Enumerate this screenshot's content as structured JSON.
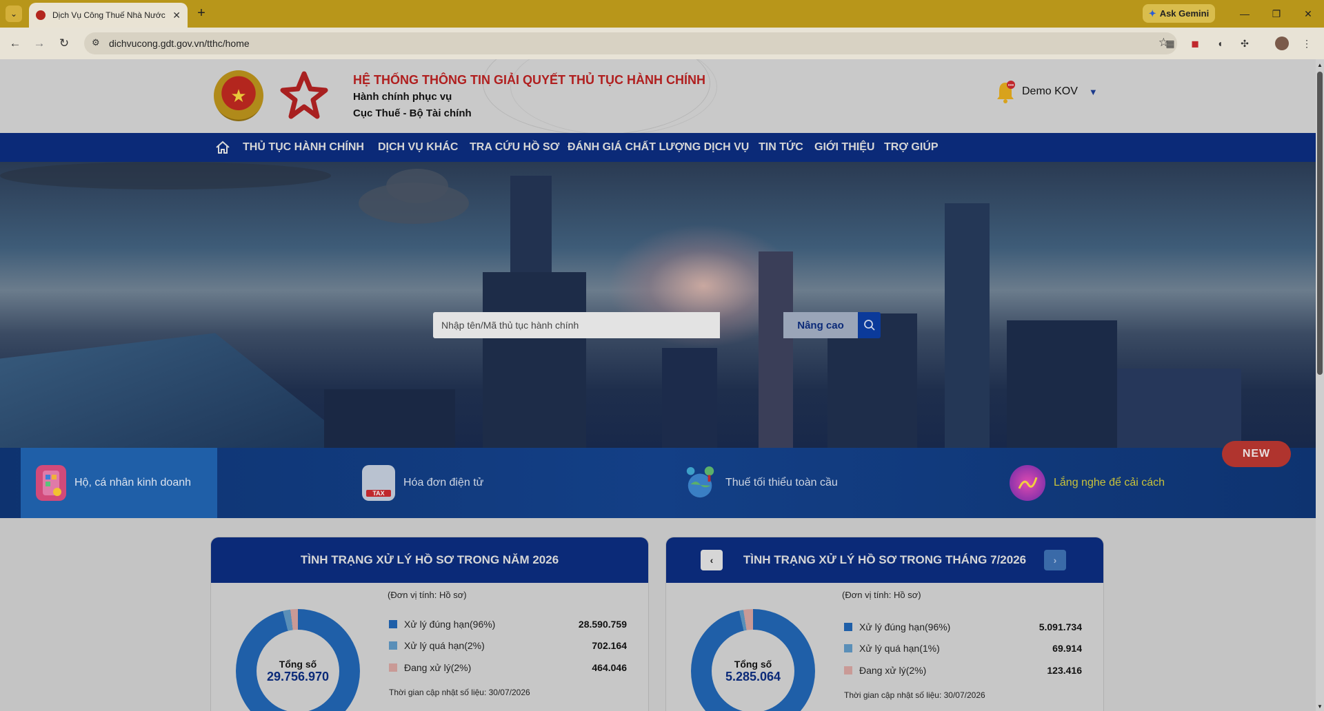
{
  "browser": {
    "tab_title": "Dịch Vụ Công Thuế Nhà Nước",
    "url": "dichvucong.gdt.gov.vn/tthc/home",
    "gemini_label": "Ask Gemini"
  },
  "header": {
    "title": "HỆ THỐNG THÔNG TIN GIẢI QUYẾT THỦ TỤC HÀNH CHÍNH",
    "subtitle1": "Hành chính phục vụ",
    "subtitle2": "Cục Thuế - Bộ Tài chính",
    "user_name": "Demo KOV"
  },
  "nav": {
    "items": [
      {
        "label": "THỦ TỤC HÀNH CHÍNH"
      },
      {
        "label": "DỊCH VỤ KHÁC"
      },
      {
        "label": "TRA CỨU HỒ SƠ"
      },
      {
        "label": "ĐÁNH GIÁ CHẤT LƯỢNG DỊCH VỤ"
      },
      {
        "label": "TIN TỨC"
      },
      {
        "label": "GIỚI THIỆU"
      },
      {
        "label": "TRỢ GIÚP"
      }
    ]
  },
  "search": {
    "placeholder": "Nhập tên/Mã thủ tục hành chính",
    "advanced_label": "Nâng cao"
  },
  "quick_links": {
    "items": [
      {
        "label": "Hộ, cá nhân kinh doanh"
      },
      {
        "label": "Hóa đơn điện tử",
        "icon_text": "TAX"
      },
      {
        "label": "Thuế tối thiểu toàn cầu"
      },
      {
        "label": "Lắng nghe để cải cách"
      }
    ],
    "new_badge": "NEW"
  },
  "stats": {
    "panels": [
      {
        "title": "TÌNH TRẠNG XỬ LÝ HỒ SƠ TRONG NĂM 2026",
        "unit": "(Đơn vị tính: Hồ sơ)",
        "total_label": "Tổng số",
        "total": "29.756.970",
        "legend": [
          {
            "label": "Xử lý đúng hạn(96%)",
            "value": "28.590.759"
          },
          {
            "label": "Xử lý quá hạn(2%)",
            "value": "702.164"
          },
          {
            "label": "Đang xử lý(2%)",
            "value": "464.046"
          }
        ],
        "updated": "Thời gian cập nhật số liệu: 30/07/2026"
      },
      {
        "title": "TÌNH TRẠNG XỬ LÝ HỒ SƠ TRONG THÁNG 7/2026",
        "unit": "(Đơn vị tính: Hồ sơ)",
        "total_label": "Tổng số",
        "total": "5.285.064",
        "legend": [
          {
            "label": "Xử lý đúng hạn(96%)",
            "value": "5.091.734"
          },
          {
            "label": "Xử lý quá hạn(1%)",
            "value": "69.914"
          },
          {
            "label": "Đang xử lý(2%)",
            "value": "123.416"
          }
        ],
        "updated": "Thời gian cập nhật số liệu: 30/07/2026"
      }
    ]
  },
  "colors": {
    "nav_bg": "#0b2a78",
    "title_red": "#b01f1f",
    "ontime": "#1f5fa8",
    "overdue": "#5a8fb8",
    "processing": "#c99a96"
  }
}
